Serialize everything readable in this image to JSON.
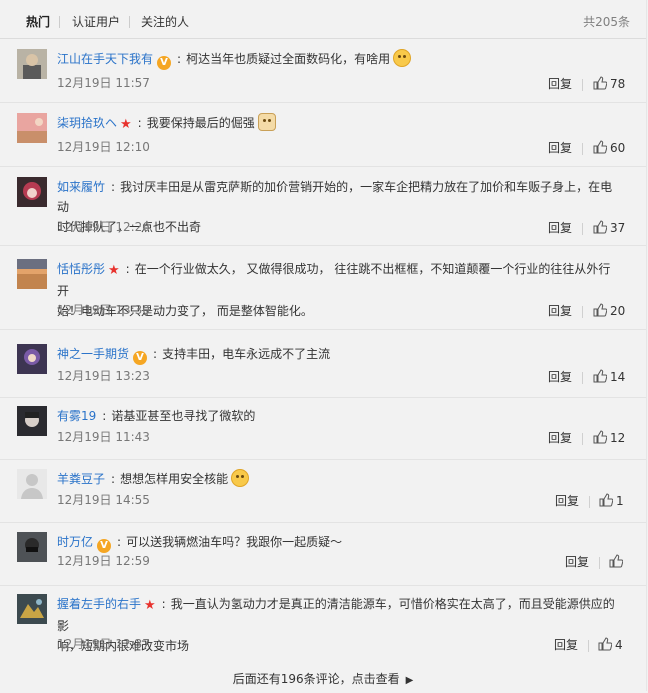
{
  "tabs": {
    "hot": "热门",
    "verified": "认证用户",
    "following": "关注的人",
    "total": "共205条"
  },
  "actions": {
    "reply": "回复"
  },
  "comments": [
    {
      "user": "江山在手天下我有",
      "badge": "V",
      "text": "柯达当年也质疑过全面数码化，有啥用",
      "emoji": "smile",
      "time": "12月19日 11:57",
      "likes": "78"
    },
    {
      "user": "柒玥拾玖ヘ",
      "badge": "★",
      "text": "我要保持最后的倔强",
      "emoji": "cat",
      "time": "12月19日 12:10",
      "likes": "60"
    },
    {
      "user": "如来履竹",
      "badge": "",
      "text": "我讨厌丰田是从雷克萨斯的加价营销开始的，一家车企把精力放在了加价和车贩子身上，在电动",
      "text2": "时代掉队了，一点也不出奇",
      "time": "12月19日 12:26",
      "likes": "37"
    },
    {
      "user": "恬恬彤彤",
      "badge": "★",
      "text": "在一个行业做太久， 又做得很成功， 往往跳不出框框，不知道颠覆一个行业的往往从外行开",
      "text2": "始！电动车不只是动力变了， 而是整体智能化。",
      "time": "12月19日 13:30",
      "likes": "20"
    },
    {
      "user": "神之一手期货",
      "badge": "V",
      "text": "支持丰田，电车永远成不了主流",
      "time": "12月19日 13:23",
      "likes": "14"
    },
    {
      "user": "有雾19",
      "badge": "",
      "text": "诺基亚甚至也寻找了微软的",
      "time": "12月19日 11:43",
      "likes": "12"
    },
    {
      "user": "羊粪豆子",
      "badge": "",
      "text": "想想怎样用安全核能",
      "emoji": "smile",
      "time": "12月19日 14:55",
      "likes": "1"
    },
    {
      "user": "时万亿",
      "badge": "V",
      "text": "可以送我辆燃油车吗？我跟你一起质疑～",
      "time": "12月19日 12:59",
      "likes": ""
    },
    {
      "user": "握着左手的右手",
      "badge": "★",
      "text": "我一直认为氢动力才是真正的清洁能源车，可惜价格实在太高了，而且受能源供应的影",
      "text2": "响，短期内很难改变市场",
      "time": "12月19日 12:37",
      "likes": "4"
    }
  ],
  "more_label": "后面还有196条评论，点击查看",
  "colors": {
    "link": "#2a73c9",
    "verified": "#f5a623",
    "star": "#e8322d"
  }
}
